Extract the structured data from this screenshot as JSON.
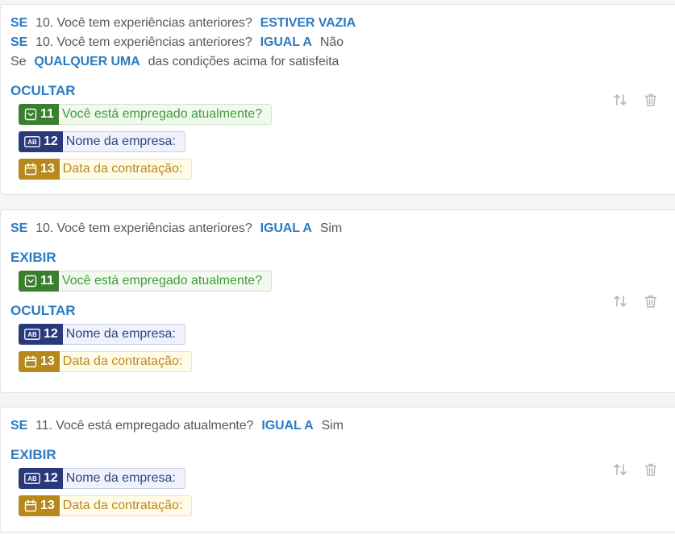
{
  "colors": {
    "accent": "#2b7bc2",
    "body-text": "#555a5f",
    "muted-icon": "#b3b7bc",
    "card-border": "#e1e4e8",
    "page-bg": "#f4f5f7",
    "green-dark": "#3a7f2f",
    "green-text": "#3f9b37",
    "green-bg": "#f2faf0",
    "green-border": "#cde6c7",
    "navy-dark": "#29397a",
    "navy-text": "#34438a",
    "navy-bg": "#eff2fa",
    "navy-border": "#c8cfe6",
    "gold-dark": "#b7891d",
    "gold-text": "#b98a1d",
    "gold-bg": "#fffbe8",
    "gold-border": "#f2e3a8"
  },
  "card_actions": {
    "move_icon": "sort-arrows-icon",
    "delete_icon": "trash-icon"
  },
  "rules": [
    {
      "conditions": [
        {
          "keyword": "SE",
          "question": "10. Você tem experiências anteriores?",
          "operator": "ESTIVER VAZIA"
        },
        {
          "keyword": "SE",
          "question": "10. Você tem experiências anteriores?",
          "operator": "IGUAL A",
          "value": "Não"
        }
      ],
      "combinator": {
        "prefix": "Se",
        "mode": "QUALQUER UMA",
        "suffix": "das condições acima for satisfeita"
      },
      "actions": [
        {
          "label": "OCULTAR",
          "fields": [
            {
              "number": "11",
              "label": "Você está empregado atualmente?",
              "icon": "dropdown-icon",
              "color": "#3a7f2f"
            },
            {
              "number": "12",
              "label": "Nome da empresa:",
              "icon": "text-field-icon",
              "icon_glyph": "AB",
              "color": "#29397a"
            },
            {
              "number": "13",
              "label": "Data da contratação:",
              "icon": "calendar-icon",
              "color": "#b7891d"
            }
          ]
        }
      ]
    },
    {
      "conditions": [
        {
          "keyword": "SE",
          "question": "10. Você tem experiências anteriores?",
          "operator": "IGUAL A",
          "value": "Sim"
        }
      ],
      "actions": [
        {
          "label": "EXIBIR",
          "fields": [
            {
              "number": "11",
              "label": "Você está empregado atualmente?",
              "icon": "dropdown-icon",
              "color": "#3a7f2f"
            }
          ]
        },
        {
          "label": "OCULTAR",
          "fields": [
            {
              "number": "12",
              "label": "Nome da empresa:",
              "icon": "text-field-icon",
              "icon_glyph": "AB",
              "color": "#29397a"
            },
            {
              "number": "13",
              "label": "Data da contratação:",
              "icon": "calendar-icon",
              "color": "#b7891d"
            }
          ]
        }
      ]
    },
    {
      "conditions": [
        {
          "keyword": "SE",
          "question": "11. Você está empregado atualmente?",
          "operator": "IGUAL A",
          "value": "Sim"
        }
      ],
      "actions": [
        {
          "label": "EXIBIR",
          "fields": [
            {
              "number": "12",
              "label": "Nome da empresa:",
              "icon": "text-field-icon",
              "icon_glyph": "AB",
              "color": "#29397a"
            },
            {
              "number": "13",
              "label": "Data da contratação:",
              "icon": "calendar-icon",
              "color": "#b7891d"
            }
          ]
        }
      ]
    }
  ]
}
